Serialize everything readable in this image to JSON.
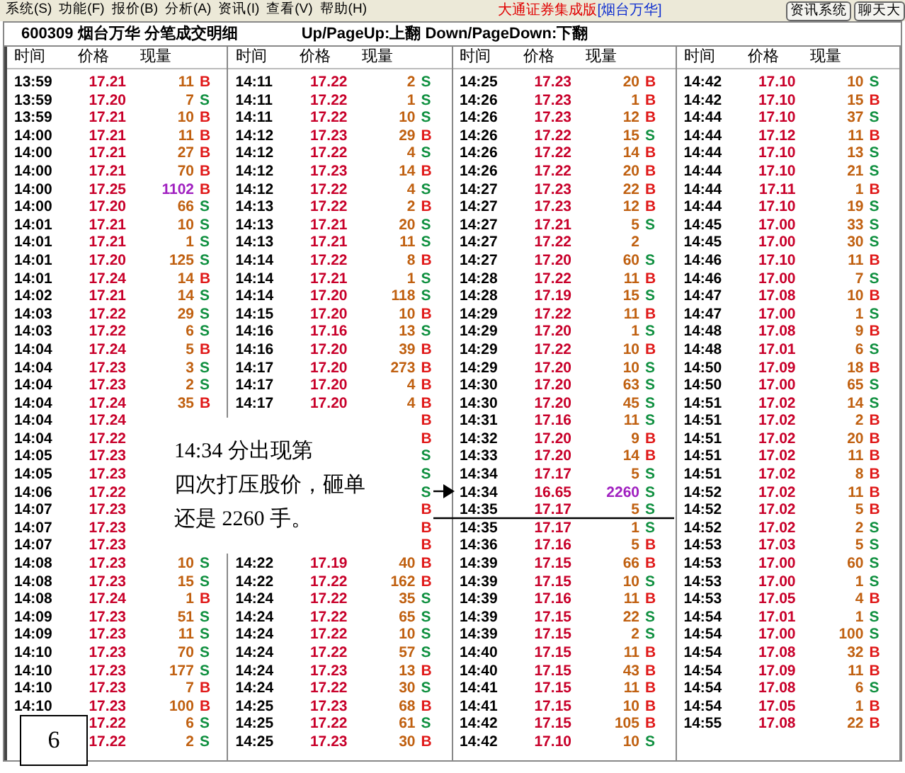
{
  "menu": [
    "系统(S)",
    "功能(F)",
    "报价(B)",
    "分析(A)",
    "资讯(I)",
    "查看(V)",
    "帮助(H)"
  ],
  "app_title": "大通证券集成版",
  "stock_tag": "[烟台万华]",
  "toolbar_buttons": [
    "资讯系统",
    "聊天大"
  ],
  "title": "600309 烟台万华 分笔成交明细",
  "hint": "Up/PageUp:上翻 Down/PageDown:下翻",
  "columns": [
    {
      "headers": [
        "时间",
        "价格",
        "现量"
      ],
      "rows": [
        {
          "time": "13:59",
          "price": "17.21",
          "volume": "11",
          "large": false,
          "side": "B",
          "buy": true
        },
        {
          "time": "13:59",
          "price": "17.20",
          "volume": "7",
          "large": false,
          "side": "S",
          "buy": false
        },
        {
          "time": "13:59",
          "price": "17.21",
          "volume": "10",
          "large": false,
          "side": "B",
          "buy": true
        },
        {
          "time": "14:00",
          "price": "17.21",
          "volume": "11",
          "large": false,
          "side": "B",
          "buy": true
        },
        {
          "time": "14:00",
          "price": "17.21",
          "volume": "27",
          "large": false,
          "side": "B",
          "buy": true
        },
        {
          "time": "14:00",
          "price": "17.21",
          "volume": "70",
          "large": false,
          "side": "B",
          "buy": true
        },
        {
          "time": "14:00",
          "price": "17.25",
          "volume": "1102",
          "large": true,
          "side": "B",
          "buy": true
        },
        {
          "time": "14:00",
          "price": "17.20",
          "volume": "66",
          "large": false,
          "side": "S",
          "buy": false
        },
        {
          "time": "14:01",
          "price": "17.21",
          "volume": "10",
          "large": false,
          "side": "S",
          "buy": false
        },
        {
          "time": "14:01",
          "price": "17.21",
          "volume": "1",
          "large": false,
          "side": "S",
          "buy": false
        },
        {
          "time": "14:01",
          "price": "17.20",
          "volume": "125",
          "large": false,
          "side": "S",
          "buy": false
        },
        {
          "time": "14:01",
          "price": "17.24",
          "volume": "14",
          "large": false,
          "side": "B",
          "buy": true
        },
        {
          "time": "14:02",
          "price": "17.21",
          "volume": "14",
          "large": false,
          "side": "S",
          "buy": false
        },
        {
          "time": "14:03",
          "price": "17.22",
          "volume": "29",
          "large": false,
          "side": "S",
          "buy": false
        },
        {
          "time": "14:03",
          "price": "17.22",
          "volume": "6",
          "large": false,
          "side": "S",
          "buy": false
        },
        {
          "time": "14:04",
          "price": "17.24",
          "volume": "5",
          "large": false,
          "side": "B",
          "buy": true
        },
        {
          "time": "14:04",
          "price": "17.23",
          "volume": "3",
          "large": false,
          "side": "S",
          "buy": false
        },
        {
          "time": "14:04",
          "price": "17.23",
          "volume": "2",
          "large": false,
          "side": "S",
          "buy": false
        },
        {
          "time": "14:04",
          "price": "17.24",
          "volume": "35",
          "large": false,
          "side": "B",
          "buy": true
        },
        {
          "time": "14:04",
          "price": "17.24"
        },
        {
          "time": "14:04",
          "price": "17.22"
        },
        {
          "time": "14:05",
          "price": "17.23"
        },
        {
          "time": "14:05",
          "price": "17.23"
        },
        {
          "time": "14:06",
          "price": "17.22"
        },
        {
          "time": "14:07",
          "price": "17.23"
        },
        {
          "time": "14:07",
          "price": "17.23"
        },
        {
          "time": "14:07",
          "price": "17.23"
        },
        {
          "time": "14:08",
          "price": "17.23",
          "volume": "10",
          "large": false,
          "side": "S",
          "buy": false
        },
        {
          "time": "14:08",
          "price": "17.23",
          "volume": "15",
          "large": false,
          "side": "S",
          "buy": false
        },
        {
          "time": "14:08",
          "price": "17.24",
          "volume": "1",
          "large": false,
          "side": "B",
          "buy": true
        },
        {
          "time": "14:09",
          "price": "17.23",
          "volume": "51",
          "large": false,
          "side": "S",
          "buy": false
        },
        {
          "time": "14:09",
          "price": "17.23",
          "volume": "11",
          "large": false,
          "side": "S",
          "buy": false
        },
        {
          "time": "14:10",
          "price": "17.23",
          "volume": "70",
          "large": false,
          "side": "S",
          "buy": false
        },
        {
          "time": "14:10",
          "price": "17.23",
          "volume": "177",
          "large": false,
          "side": "S",
          "buy": false
        },
        {
          "time": "14:10",
          "price": "17.23",
          "volume": "7",
          "large": false,
          "side": "B",
          "buy": true
        },
        {
          "time": "14:10",
          "price": "17.23",
          "volume": "100",
          "large": false,
          "side": "B",
          "buy": true
        },
        {
          "price": "17.22",
          "volume": "6",
          "large": false,
          "side": "S",
          "buy": false
        },
        {
          "price": "17.22",
          "volume": "2",
          "large": false,
          "side": "S",
          "buy": false
        }
      ]
    },
    {
      "headers": [
        "时间",
        "价格",
        "现量"
      ],
      "rows": [
        {
          "time": "14:11",
          "price": "17.22",
          "volume": "2",
          "large": false,
          "side": "S",
          "buy": false
        },
        {
          "time": "14:11",
          "price": "17.22",
          "volume": "1",
          "large": false,
          "side": "S",
          "buy": false
        },
        {
          "time": "14:11",
          "price": "17.22",
          "volume": "10",
          "large": false,
          "side": "S",
          "buy": false
        },
        {
          "time": "14:12",
          "price": "17.23",
          "volume": "29",
          "large": false,
          "side": "B",
          "buy": true
        },
        {
          "time": "14:12",
          "price": "17.22",
          "volume": "4",
          "large": false,
          "side": "S",
          "buy": false
        },
        {
          "time": "14:12",
          "price": "17.23",
          "volume": "14",
          "large": false,
          "side": "B",
          "buy": true
        },
        {
          "time": "14:12",
          "price": "17.22",
          "volume": "4",
          "large": false,
          "side": "S",
          "buy": false
        },
        {
          "time": "14:13",
          "price": "17.22",
          "volume": "2",
          "large": false,
          "side": "B",
          "buy": true
        },
        {
          "time": "14:13",
          "price": "17.21",
          "volume": "20",
          "large": false,
          "side": "S",
          "buy": false
        },
        {
          "time": "14:13",
          "price": "17.21",
          "volume": "11",
          "large": false,
          "side": "S",
          "buy": false
        },
        {
          "time": "14:14",
          "price": "17.22",
          "volume": "8",
          "large": false,
          "side": "B",
          "buy": true
        },
        {
          "time": "14:14",
          "price": "17.21",
          "volume": "1",
          "large": false,
          "side": "S",
          "buy": false
        },
        {
          "time": "14:14",
          "price": "17.20",
          "volume": "118",
          "large": false,
          "side": "S",
          "buy": false
        },
        {
          "time": "14:15",
          "price": "17.20",
          "volume": "10",
          "large": false,
          "side": "B",
          "buy": true
        },
        {
          "time": "14:16",
          "price": "17.16",
          "volume": "13",
          "large": false,
          "side": "S",
          "buy": false
        },
        {
          "time": "14:16",
          "price": "17.20",
          "volume": "39",
          "large": false,
          "side": "B",
          "buy": true
        },
        {
          "time": "14:17",
          "price": "17.20",
          "volume": "273",
          "large": false,
          "side": "B",
          "buy": true
        },
        {
          "time": "14:17",
          "price": "17.20",
          "volume": "4",
          "large": false,
          "side": "B",
          "buy": true
        },
        {
          "time": "14:17",
          "price": "17.20",
          "volume": "4",
          "large": false,
          "side": "B",
          "buy": true
        },
        {
          "side": "B",
          "buy": true
        },
        {
          "side": "B",
          "buy": true
        },
        {
          "side": "S",
          "buy": false
        },
        {
          "side": "S",
          "buy": false
        },
        {
          "side": "S",
          "buy": false
        },
        {
          "side": "B",
          "buy": true
        },
        {
          "side": "B",
          "buy": true
        },
        {
          "side": "B",
          "buy": true
        },
        {
          "time": "14:22",
          "price": "17.19",
          "volume": "40",
          "large": false,
          "side": "B",
          "buy": true
        },
        {
          "time": "14:22",
          "price": "17.22",
          "volume": "162",
          "large": false,
          "side": "B",
          "buy": true
        },
        {
          "time": "14:24",
          "price": "17.22",
          "volume": "35",
          "large": false,
          "side": "S",
          "buy": false
        },
        {
          "time": "14:24",
          "price": "17.22",
          "volume": "65",
          "large": false,
          "side": "S",
          "buy": false
        },
        {
          "time": "14:24",
          "price": "17.22",
          "volume": "10",
          "large": false,
          "side": "S",
          "buy": false
        },
        {
          "time": "14:24",
          "price": "17.22",
          "volume": "57",
          "large": false,
          "side": "S",
          "buy": false
        },
        {
          "time": "14:24",
          "price": "17.23",
          "volume": "13",
          "large": false,
          "side": "B",
          "buy": true
        },
        {
          "time": "14:24",
          "price": "17.22",
          "volume": "30",
          "large": false,
          "side": "S",
          "buy": false
        },
        {
          "time": "14:25",
          "price": "17.23",
          "volume": "68",
          "large": false,
          "side": "B",
          "buy": true
        },
        {
          "time": "14:25",
          "price": "17.22",
          "volume": "61",
          "large": false,
          "side": "S",
          "buy": false
        },
        {
          "time": "14:25",
          "price": "17.23",
          "volume": "30",
          "large": false,
          "side": "B",
          "buy": true
        }
      ]
    },
    {
      "headers": [
        "时间",
        "价格",
        "现量"
      ],
      "rows": [
        {
          "time": "14:25",
          "price": "17.23",
          "volume": "20",
          "large": false,
          "side": "B",
          "buy": true
        },
        {
          "time": "14:26",
          "price": "17.23",
          "volume": "1",
          "large": false,
          "side": "B",
          "buy": true
        },
        {
          "time": "14:26",
          "price": "17.23",
          "volume": "12",
          "large": false,
          "side": "B",
          "buy": true
        },
        {
          "time": "14:26",
          "price": "17.22",
          "volume": "15",
          "large": false,
          "side": "S",
          "buy": false
        },
        {
          "time": "14:26",
          "price": "17.22",
          "volume": "14",
          "large": false,
          "side": "B",
          "buy": true
        },
        {
          "time": "14:26",
          "price": "17.22",
          "volume": "20",
          "large": false,
          "side": "B",
          "buy": true
        },
        {
          "time": "14:27",
          "price": "17.23",
          "volume": "22",
          "large": false,
          "side": "B",
          "buy": true
        },
        {
          "time": "14:27",
          "price": "17.23",
          "volume": "12",
          "large": false,
          "side": "B",
          "buy": true
        },
        {
          "time": "14:27",
          "price": "17.21",
          "volume": "5",
          "large": false,
          "side": "S",
          "buy": false
        },
        {
          "time": "14:27",
          "price": "17.22",
          "volume": "2",
          "large": false
        },
        {
          "time": "14:27",
          "price": "17.20",
          "volume": "60",
          "large": false,
          "side": "S",
          "buy": false
        },
        {
          "time": "14:28",
          "price": "17.22",
          "volume": "11",
          "large": false,
          "side": "B",
          "buy": true
        },
        {
          "time": "14:28",
          "price": "17.19",
          "volume": "15",
          "large": false,
          "side": "S",
          "buy": false
        },
        {
          "time": "14:29",
          "price": "17.22",
          "volume": "11",
          "large": false,
          "side": "B",
          "buy": true
        },
        {
          "time": "14:29",
          "price": "17.20",
          "volume": "1",
          "large": false,
          "side": "S",
          "buy": false
        },
        {
          "time": "14:29",
          "price": "17.22",
          "volume": "10",
          "large": false,
          "side": "B",
          "buy": true
        },
        {
          "time": "14:29",
          "price": "17.20",
          "volume": "10",
          "large": false,
          "side": "S",
          "buy": false
        },
        {
          "time": "14:30",
          "price": "17.20",
          "volume": "63",
          "large": false,
          "side": "S",
          "buy": false
        },
        {
          "time": "14:30",
          "price": "17.20",
          "volume": "45",
          "large": false,
          "side": "S",
          "buy": false
        },
        {
          "time": "14:31",
          "price": "17.16",
          "volume": "11",
          "large": false,
          "side": "S",
          "buy": false
        },
        {
          "time": "14:32",
          "price": "17.20",
          "volume": "9",
          "large": false,
          "side": "B",
          "buy": true
        },
        {
          "time": "14:33",
          "price": "17.20",
          "volume": "14",
          "large": false,
          "side": "B",
          "buy": true
        },
        {
          "time": "14:34",
          "price": "17.17",
          "volume": "5",
          "large": false,
          "side": "S",
          "buy": false
        },
        {
          "time": "14:34",
          "price": "16.65",
          "volume": "2260",
          "large": true,
          "side": "S",
          "buy": false
        },
        {
          "time": "14:35",
          "price": "17.17",
          "volume": "5",
          "large": false,
          "side": "S",
          "buy": false
        },
        {
          "time": "14:35",
          "price": "17.17",
          "volume": "1",
          "large": false,
          "side": "S",
          "buy": false
        },
        {
          "time": "14:36",
          "price": "17.16",
          "volume": "5",
          "large": false,
          "side": "B",
          "buy": true
        },
        {
          "time": "14:39",
          "price": "17.15",
          "volume": "66",
          "large": false,
          "side": "B",
          "buy": true
        },
        {
          "time": "14:39",
          "price": "17.15",
          "volume": "10",
          "large": false,
          "side": "S",
          "buy": false
        },
        {
          "time": "14:39",
          "price": "17.16",
          "volume": "11",
          "large": false,
          "side": "B",
          "buy": true
        },
        {
          "time": "14:39",
          "price": "17.15",
          "volume": "22",
          "large": false,
          "side": "S",
          "buy": false
        },
        {
          "time": "14:39",
          "price": "17.15",
          "volume": "2",
          "large": false,
          "side": "S",
          "buy": false
        },
        {
          "time": "14:40",
          "price": "17.15",
          "volume": "11",
          "large": false,
          "side": "B",
          "buy": true
        },
        {
          "time": "14:40",
          "price": "17.15",
          "volume": "43",
          "large": false,
          "side": "B",
          "buy": true
        },
        {
          "time": "14:41",
          "price": "17.15",
          "volume": "11",
          "large": false,
          "side": "B",
          "buy": true
        },
        {
          "time": "14:41",
          "price": "17.15",
          "volume": "10",
          "large": false,
          "side": "B",
          "buy": true
        },
        {
          "time": "14:42",
          "price": "17.15",
          "volume": "105",
          "large": false,
          "side": "B",
          "buy": true
        },
        {
          "time": "14:42",
          "price": "17.10",
          "volume": "10",
          "large": false,
          "side": "S",
          "buy": false
        }
      ]
    },
    {
      "headers": [
        "时间",
        "价格",
        "现量"
      ],
      "rows": [
        {
          "time": "14:42",
          "price": "17.10",
          "volume": "10",
          "large": false,
          "side": "S",
          "buy": false
        },
        {
          "time": "14:42",
          "price": "17.10",
          "volume": "15",
          "large": false,
          "side": "B",
          "buy": true
        },
        {
          "time": "14:44",
          "price": "17.10",
          "volume": "37",
          "large": false,
          "side": "S",
          "buy": false
        },
        {
          "time": "14:44",
          "price": "17.12",
          "volume": "11",
          "large": false,
          "side": "B",
          "buy": true
        },
        {
          "time": "14:44",
          "price": "17.10",
          "volume": "13",
          "large": false,
          "side": "S",
          "buy": false
        },
        {
          "time": "14:44",
          "price": "17.10",
          "volume": "21",
          "large": false,
          "side": "S",
          "buy": false
        },
        {
          "time": "14:44",
          "price": "17.11",
          "volume": "1",
          "large": false,
          "side": "B",
          "buy": true
        },
        {
          "time": "14:44",
          "price": "17.10",
          "volume": "19",
          "large": false,
          "side": "S",
          "buy": false
        },
        {
          "time": "14:45",
          "price": "17.00",
          "volume": "33",
          "large": false,
          "side": "S",
          "buy": false
        },
        {
          "time": "14:45",
          "price": "17.00",
          "volume": "30",
          "large": false,
          "side": "S",
          "buy": false
        },
        {
          "time": "14:46",
          "price": "17.10",
          "volume": "11",
          "large": false,
          "side": "B",
          "buy": true
        },
        {
          "time": "14:46",
          "price": "17.00",
          "volume": "7",
          "large": false,
          "side": "S",
          "buy": false
        },
        {
          "time": "14:47",
          "price": "17.08",
          "volume": "10",
          "large": false,
          "side": "B",
          "buy": true
        },
        {
          "time": "14:47",
          "price": "17.00",
          "volume": "1",
          "large": false,
          "side": "S",
          "buy": false
        },
        {
          "time": "14:48",
          "price": "17.08",
          "volume": "9",
          "large": false,
          "side": "B",
          "buy": true
        },
        {
          "time": "14:48",
          "price": "17.01",
          "volume": "6",
          "large": false,
          "side": "S",
          "buy": false
        },
        {
          "time": "14:50",
          "price": "17.09",
          "volume": "18",
          "large": false,
          "side": "B",
          "buy": true
        },
        {
          "time": "14:50",
          "price": "17.00",
          "volume": "65",
          "large": false,
          "side": "S",
          "buy": false
        },
        {
          "time": "14:51",
          "price": "17.02",
          "volume": "14",
          "large": false,
          "side": "S",
          "buy": false
        },
        {
          "time": "14:51",
          "price": "17.02",
          "volume": "2",
          "large": false,
          "side": "B",
          "buy": true
        },
        {
          "time": "14:51",
          "price": "17.02",
          "volume": "20",
          "large": false,
          "side": "B",
          "buy": true
        },
        {
          "time": "14:51",
          "price": "17.02",
          "volume": "11",
          "large": false,
          "side": "B",
          "buy": true
        },
        {
          "time": "14:51",
          "price": "17.02",
          "volume": "8",
          "large": false,
          "side": "B",
          "buy": true
        },
        {
          "time": "14:52",
          "price": "17.02",
          "volume": "11",
          "large": false,
          "side": "B",
          "buy": true
        },
        {
          "time": "14:52",
          "price": "17.02",
          "volume": "5",
          "large": false,
          "side": "B",
          "buy": true
        },
        {
          "time": "14:52",
          "price": "17.02",
          "volume": "2",
          "large": false,
          "side": "S",
          "buy": false
        },
        {
          "time": "14:53",
          "price": "17.03",
          "volume": "5",
          "large": false,
          "side": "S",
          "buy": false
        },
        {
          "time": "14:53",
          "price": "17.00",
          "volume": "60",
          "large": false,
          "side": "S",
          "buy": false
        },
        {
          "time": "14:53",
          "price": "17.00",
          "volume": "1",
          "large": false,
          "side": "S",
          "buy": false
        },
        {
          "time": "14:53",
          "price": "17.05",
          "volume": "4",
          "large": false,
          "side": "B",
          "buy": true
        },
        {
          "time": "14:54",
          "price": "17.01",
          "volume": "1",
          "large": false,
          "side": "S",
          "buy": false
        },
        {
          "time": "14:54",
          "price": "17.00",
          "volume": "100",
          "large": false,
          "side": "S",
          "buy": false
        },
        {
          "time": "14:54",
          "price": "17.08",
          "volume": "32",
          "large": false,
          "side": "B",
          "buy": true
        },
        {
          "time": "14:54",
          "price": "17.09",
          "volume": "11",
          "large": false,
          "side": "B",
          "buy": true
        },
        {
          "time": "14:54",
          "price": "17.08",
          "volume": "6",
          "large": false,
          "side": "S",
          "buy": false
        },
        {
          "time": "14:54",
          "price": "17.05",
          "volume": "1",
          "large": false,
          "side": "B",
          "buy": true
        },
        {
          "time": "14:55",
          "price": "17.08",
          "volume": "22",
          "large": false,
          "side": "B",
          "buy": true
        }
      ]
    }
  ],
  "annotation": {
    "lines": [
      "14:34 分出现第",
      "四次打压股价，砸单",
      "还是 2260 手。"
    ]
  },
  "figure_number": "6"
}
